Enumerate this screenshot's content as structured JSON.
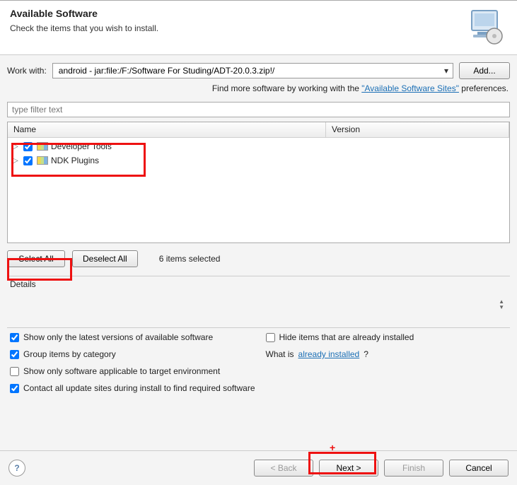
{
  "header": {
    "title": "Available Software",
    "subtitle": "Check the items that you wish to install."
  },
  "work_with": {
    "label": "Work with:",
    "value": "android - jar:file:/F:/Software For Studing/ADT-20.0.3.zip!/",
    "add_label": "Add..."
  },
  "info_line": {
    "prefix": "Find more software by working with the ",
    "link": "\"Available Software Sites\"",
    "suffix": " preferences."
  },
  "filter_placeholder": "type filter text",
  "columns": {
    "name": "Name",
    "version": "Version"
  },
  "tree": [
    {
      "label": "Developer Tools",
      "checked": true
    },
    {
      "label": "NDK Plugins",
      "checked": true
    }
  ],
  "buttons": {
    "select_all": "Select All",
    "deselect_all": "Deselect All",
    "back": "< Back",
    "next": "Next >",
    "finish": "Finish",
    "cancel": "Cancel"
  },
  "selected_text": "6 items selected",
  "details_label": "Details",
  "options": {
    "latest": "Show only the latest versions of available software",
    "hide_installed": "Hide items that are already installed",
    "group": "Group items by category",
    "what_is_prefix": "What is ",
    "what_is_link": "already installed",
    "what_is_suffix": "?",
    "target_env": "Show only software applicable to target environment",
    "contact_sites": "Contact all update sites during install to find required software"
  },
  "checks": {
    "latest": true,
    "hide_installed": false,
    "group": true,
    "target_env": false,
    "contact_sites": true
  }
}
